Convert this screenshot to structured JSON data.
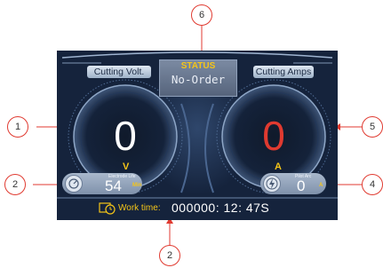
{
  "header": {
    "left_label": "Cutting Volt.",
    "right_label": "Cutting Amps",
    "status_title": "STATUS",
    "status_value": "No-Order"
  },
  "gauges": {
    "voltage": {
      "value": "0",
      "unit": "V",
      "color": "#ffffff"
    },
    "amps": {
      "value": "0",
      "unit": "A",
      "color": "#e03a30"
    }
  },
  "electrode": {
    "label": "Electrode Life",
    "value": "54",
    "unit": "Min",
    "icon": "gauge-icon"
  },
  "pilot_arc": {
    "label": "Pilot Arc",
    "value": "0",
    "unit": "A",
    "icon": "bolt-icon"
  },
  "work_time": {
    "label": "Work time:",
    "value": "000000:  12:  47S",
    "icon": "clock-icon"
  },
  "callouts": [
    "1",
    "2",
    "2",
    "4",
    "5",
    "6"
  ],
  "colors": {
    "accent": "#f5c518",
    "screen_bg": "#15233c",
    "callout_border": "#e03a30"
  }
}
